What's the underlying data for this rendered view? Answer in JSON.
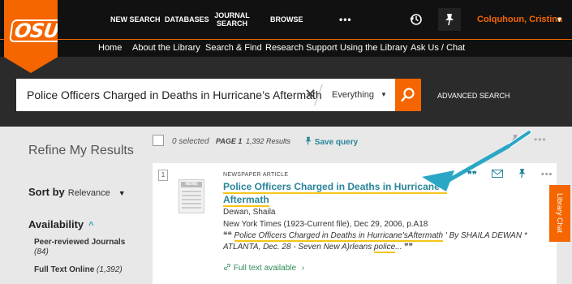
{
  "header": {
    "logo_text": "OSU",
    "nav": {
      "new_search": "NEW SEARCH",
      "databases": "DATABASES",
      "journal_search": "JOURNAL SEARCH",
      "browse": "BROWSE",
      "more": "•••"
    },
    "user_name": "Colquhoun, Cristina"
  },
  "subnav": {
    "home": "Home",
    "about": "About the Library",
    "search_find": "Search & Find",
    "research_support": "Research Support",
    "using_library": "Using the Library",
    "ask_us": "Ask Us / Chat"
  },
  "search": {
    "query": "Police Officers Charged in Deaths in Hurricane’s Aftermath",
    "scope": "Everything",
    "advanced": "ADVANCED SEARCH"
  },
  "sidebar": {
    "refine_title": "Refine My Results",
    "sort_label": "Sort by",
    "sort_value": "Relevance",
    "availability_label": "Availability",
    "facets": [
      {
        "label": "Peer-reviewed Journals",
        "count": "(84)"
      },
      {
        "label": "Full Text Online",
        "count": "(1,392)"
      }
    ]
  },
  "results_bar": {
    "selected": "0 selected",
    "page": "PAGE 1",
    "count": "1,392 Results",
    "save_query": "Save query"
  },
  "result": {
    "index": "1",
    "doc_type": "NEWSPAPER ARTICLE",
    "thumb_label": "NEWS",
    "title": "Police Officers Charged in Deaths in Hurricane's Aftermath",
    "author": "Dewan, Shaila",
    "source": "New York Times (1923-Current file), Dec 29, 2006, p.A18",
    "snippet_hl": "Police Officers Charged in Deaths in Hurricane'sAftermath",
    "snippet_mid": " ' By SHAILA DEWAN * ATLANTA, Dec. 28 - Seven New A)rleans ",
    "snippet_hl2": "police",
    "snippet_end": "...",
    "full_text": "Full text available",
    "quote_open": "❝❝",
    "quote_close": "❞❞"
  },
  "library_chat": "Library Chat",
  "colors": {
    "brand_orange": "#f56600",
    "teal": "#29849a",
    "highlight": "#f5c518"
  }
}
